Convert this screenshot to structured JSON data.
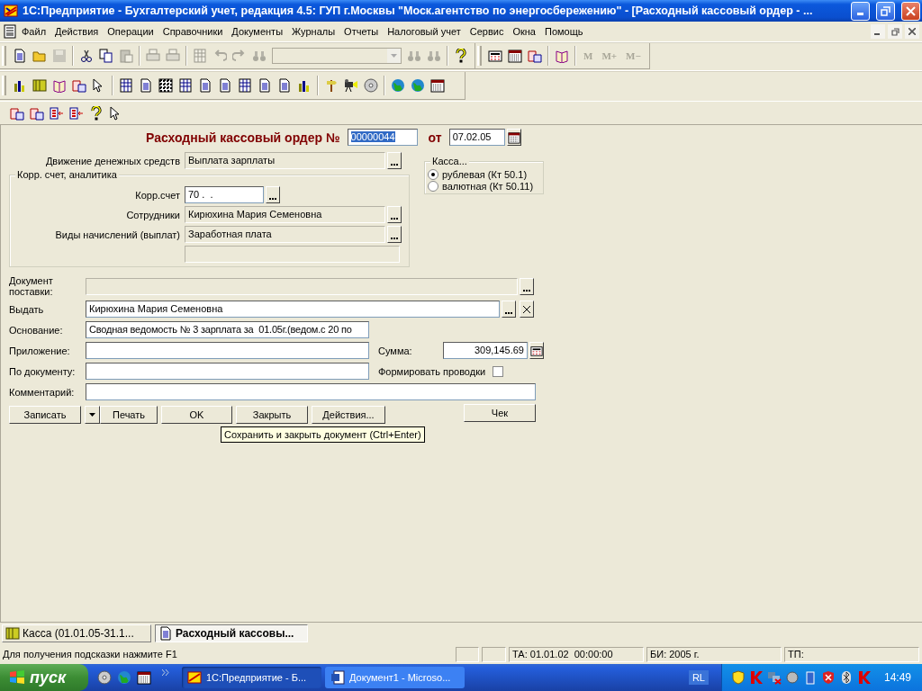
{
  "window": {
    "title": "1С:Предприятие - Бухгалтерский учет, редакция 4.5: ГУП г.Москвы \"Моск.агентство по энергосбережению\" - [Расходный кассовый ордер - ..."
  },
  "menu": [
    "Файл",
    "Действия",
    "Операции",
    "Справочники",
    "Документы",
    "Журналы",
    "Отчеты",
    "Налоговый учет",
    "Сервис",
    "Окна",
    "Помощь"
  ],
  "toolbar": {
    "memory_buttons": [
      {
        "label": "M",
        "disabled": true
      },
      {
        "label": "M+",
        "disabled": true
      },
      {
        "label": "M−",
        "disabled": true
      }
    ]
  },
  "form": {
    "title": "Расходный кассовый ордер №",
    "number": {
      "value": "00000044",
      "text_selected": true
    },
    "date_label": "от",
    "date": {
      "value": "07.02.05"
    },
    "cash_flow": {
      "label": "Движение денежных средств",
      "value": "Выплата зарплаты",
      "disabled": true
    },
    "kassa": {
      "title": "Касса...",
      "options": [
        {
          "label": "рублевая (Кт 50.1)",
          "selected": true
        },
        {
          "label": "валютная (Кт 50.11)",
          "selected": false
        }
      ]
    },
    "corr_group": {
      "title": "Корр. счет, аналитика",
      "account": {
        "label": "Корр.счет",
        "value": "70 .  .",
        "disabled": false
      },
      "fields": [
        {
          "label": "Сотрудники",
          "value": "Кирюхина Мария Семеновна",
          "disabled": true
        },
        {
          "label": "Виды начислений (выплат)",
          "value": "Заработная плата",
          "disabled": true
        }
      ]
    },
    "supply_document": {
      "label": "Документ поставки:",
      "disabled": true
    },
    "issue_to": {
      "label": "Выдать",
      "value": "Кирюхина Мария Семеновна",
      "disabled": false
    },
    "basis": {
      "label": "Основание:",
      "value": "Сводная ведомость № 3 зарплата за  01.05г.(ведом.с 20 по",
      "disabled": false
    },
    "attachment": {
      "label": "Приложение:",
      "disabled": false
    },
    "sum": {
      "label": "Сумма:",
      "value": "309,145.69"
    },
    "by_document": {
      "label": "По документу:",
      "disabled": false
    },
    "postings": {
      "label": "Формировать проводки",
      "checked": false
    },
    "comment": {
      "label": "Комментарий:",
      "disabled": false
    },
    "buttons": [
      "Записать",
      "Печать",
      "OK",
      "Закрыть",
      "Действия..."
    ],
    "receipt_button": "Чек",
    "tooltip": "Сохранить и закрыть документ (Ctrl+Enter)"
  },
  "window_tabs": [
    {
      "label": "Касса (01.01.05-31.1...",
      "selected": false
    },
    {
      "label": "Расходный кассовы...",
      "selected": true
    }
  ],
  "status_bar": {
    "hint": "Для получения подсказки нажмите F1",
    "ta": "ТА: 01.01.02  00:00:00",
    "bi": "БИ: 2005 г.",
    "tp": "ТП:"
  },
  "taskbar": {
    "start": "пуск",
    "tasks": [
      {
        "label": "1С:Предприятие - Б...",
        "selected": true
      },
      {
        "label": "Документ1 - Microso...",
        "selected": false
      }
    ],
    "language": "RL",
    "clock": "14:49"
  }
}
